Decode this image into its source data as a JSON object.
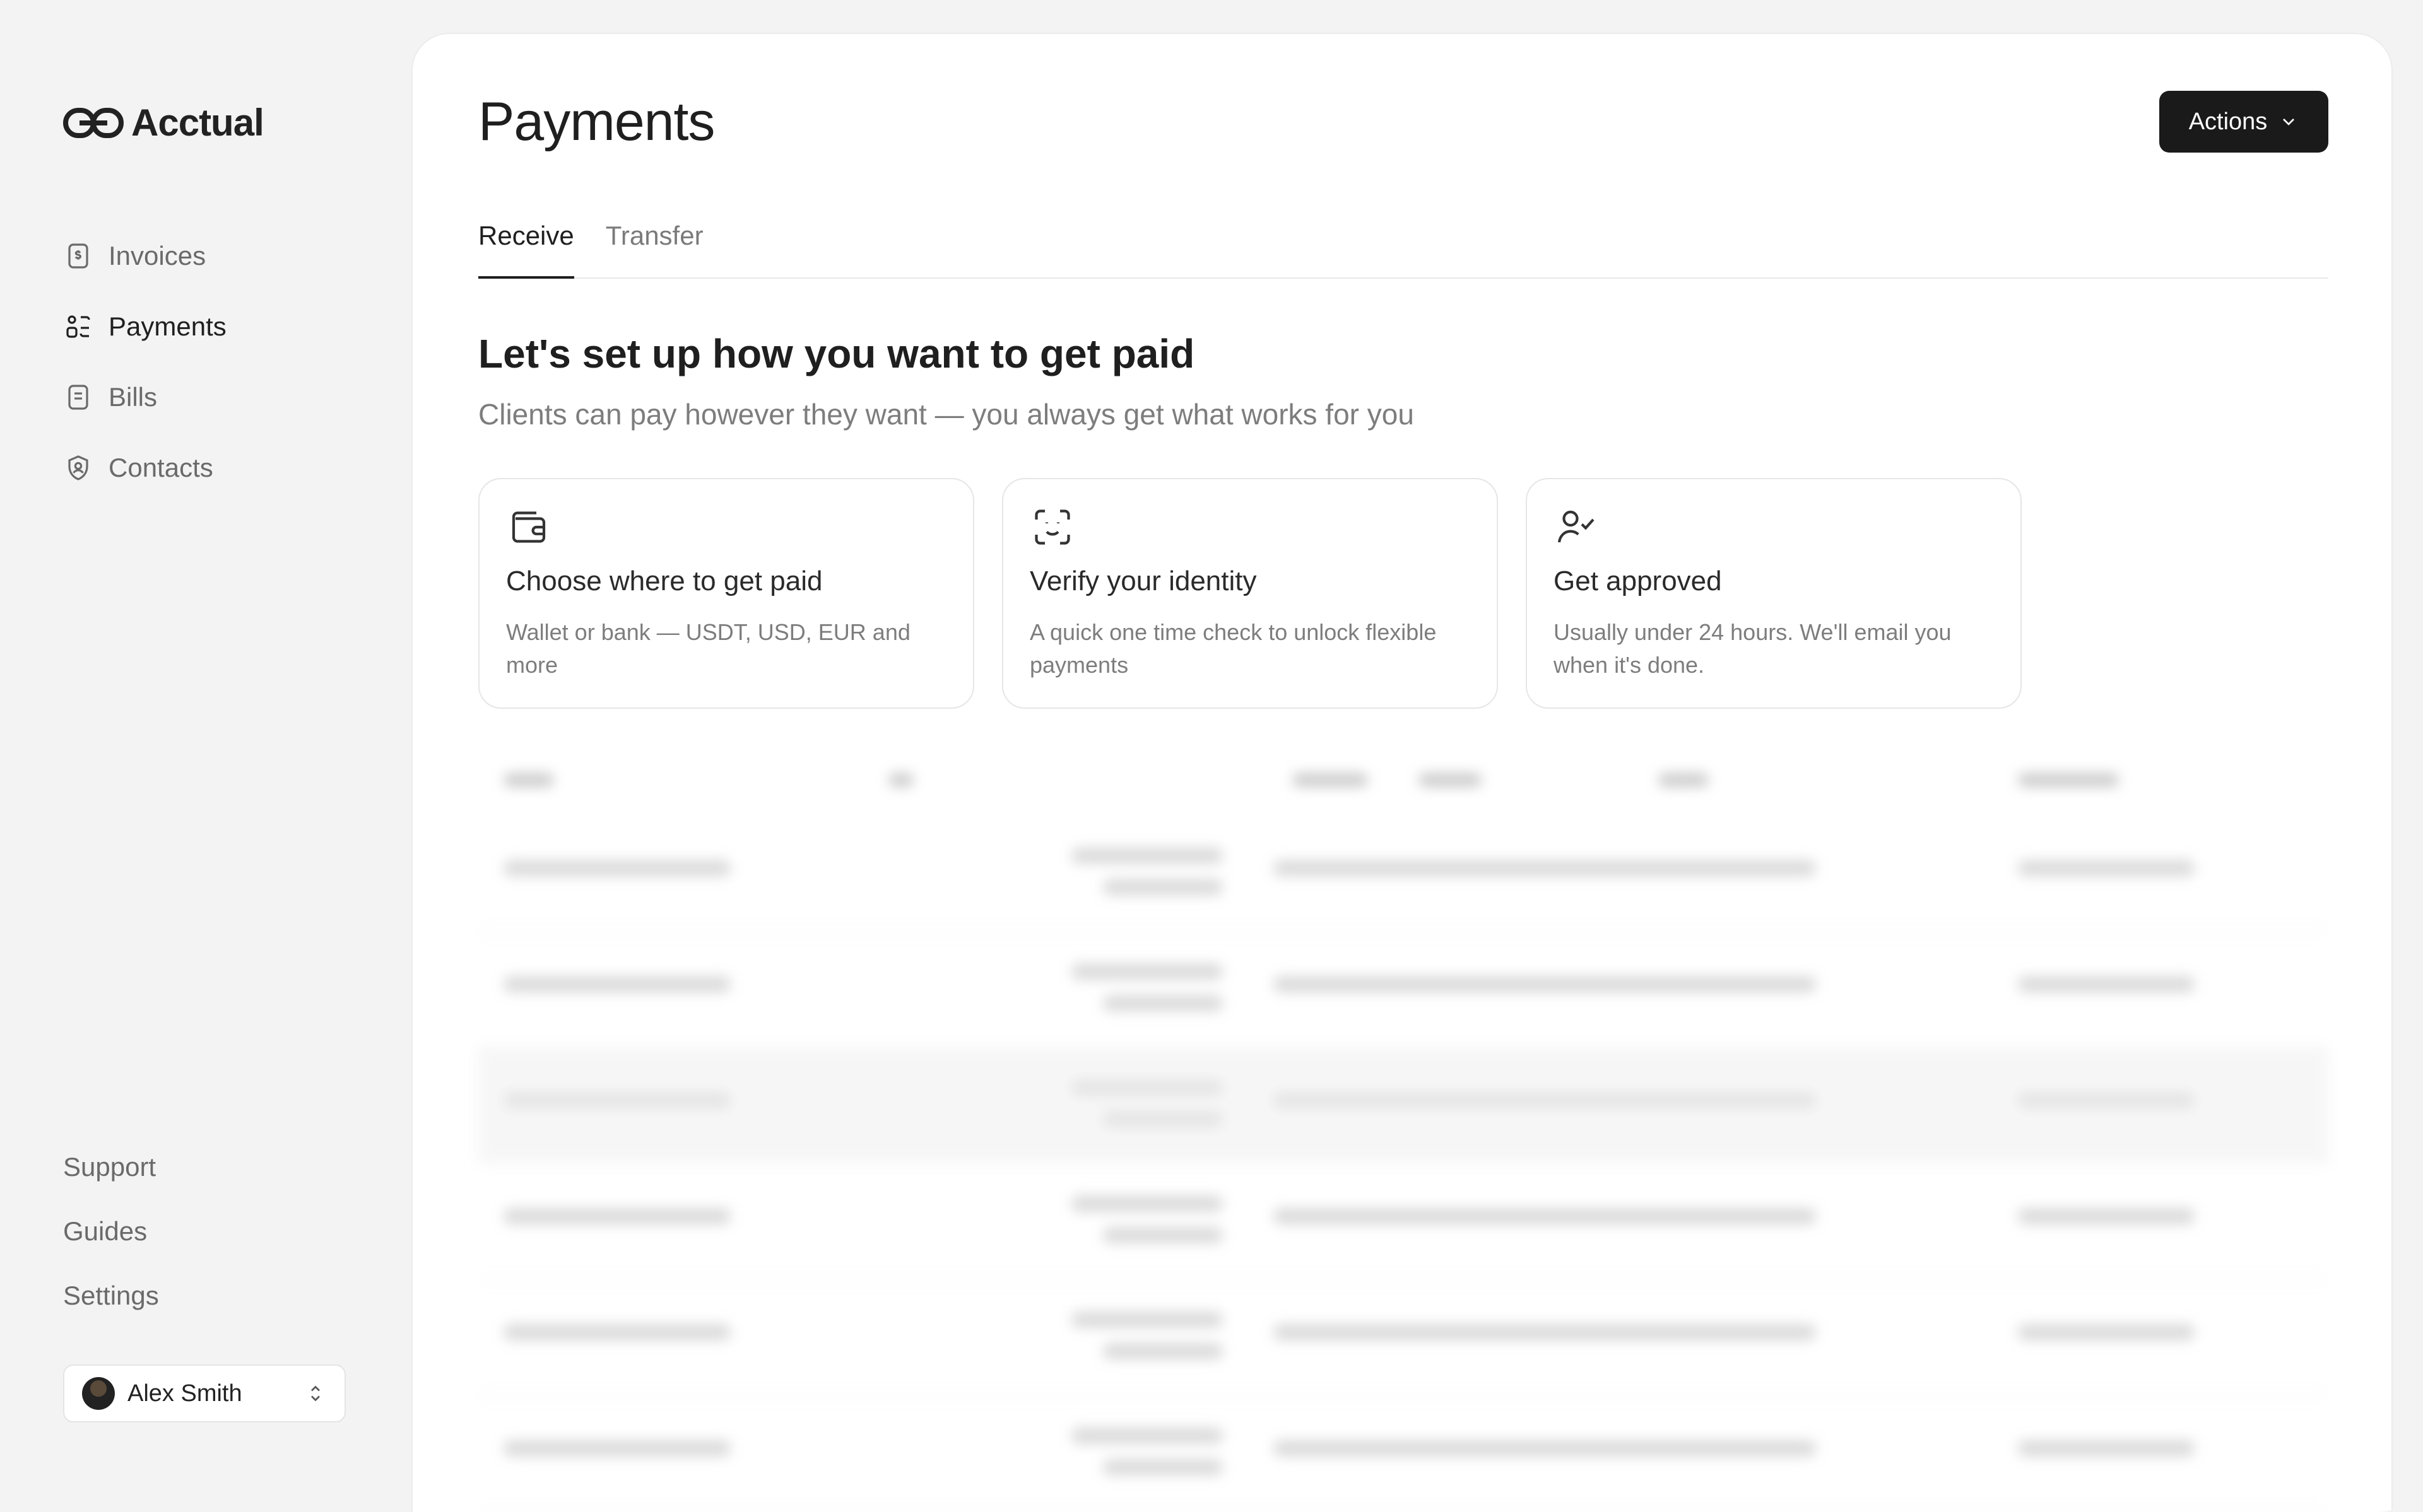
{
  "app": {
    "brand": "Acctual"
  },
  "sidebar": {
    "nav": [
      {
        "label": "Invoices",
        "icon": "invoice-dollar-icon",
        "active": false
      },
      {
        "label": "Payments",
        "icon": "payments-icon",
        "active": true
      },
      {
        "label": "Bills",
        "icon": "bill-icon",
        "active": false
      },
      {
        "label": "Contacts",
        "icon": "contact-shield-icon",
        "active": false
      }
    ],
    "bottom_links": [
      "Support",
      "Guides",
      "Settings"
    ],
    "user": {
      "name": "Alex Smith"
    }
  },
  "main": {
    "title": "Payments",
    "actions_label": "Actions",
    "tabs": [
      {
        "label": "Receive",
        "active": true
      },
      {
        "label": "Transfer",
        "active": false
      }
    ],
    "heading": "Let's set up how you want to get paid",
    "subheading": "Clients can pay however they want — you always get what works for you",
    "cards": [
      {
        "icon": "wallet-icon",
        "title": "Choose where to get paid",
        "desc": "Wallet or bank — USDT, USD, EUR and more"
      },
      {
        "icon": "face-scan-icon",
        "title": "Verify your identity",
        "desc": "A quick one time check to unlock flexible payments"
      },
      {
        "icon": "user-check-icon",
        "title": "Get approved",
        "desc": "Usually under 24 hours. We'll email you when it's done."
      }
    ]
  },
  "colors": {
    "accent": "#1a1a1a",
    "muted_text": "#7d7d7d",
    "background": "#f3f3f3"
  }
}
